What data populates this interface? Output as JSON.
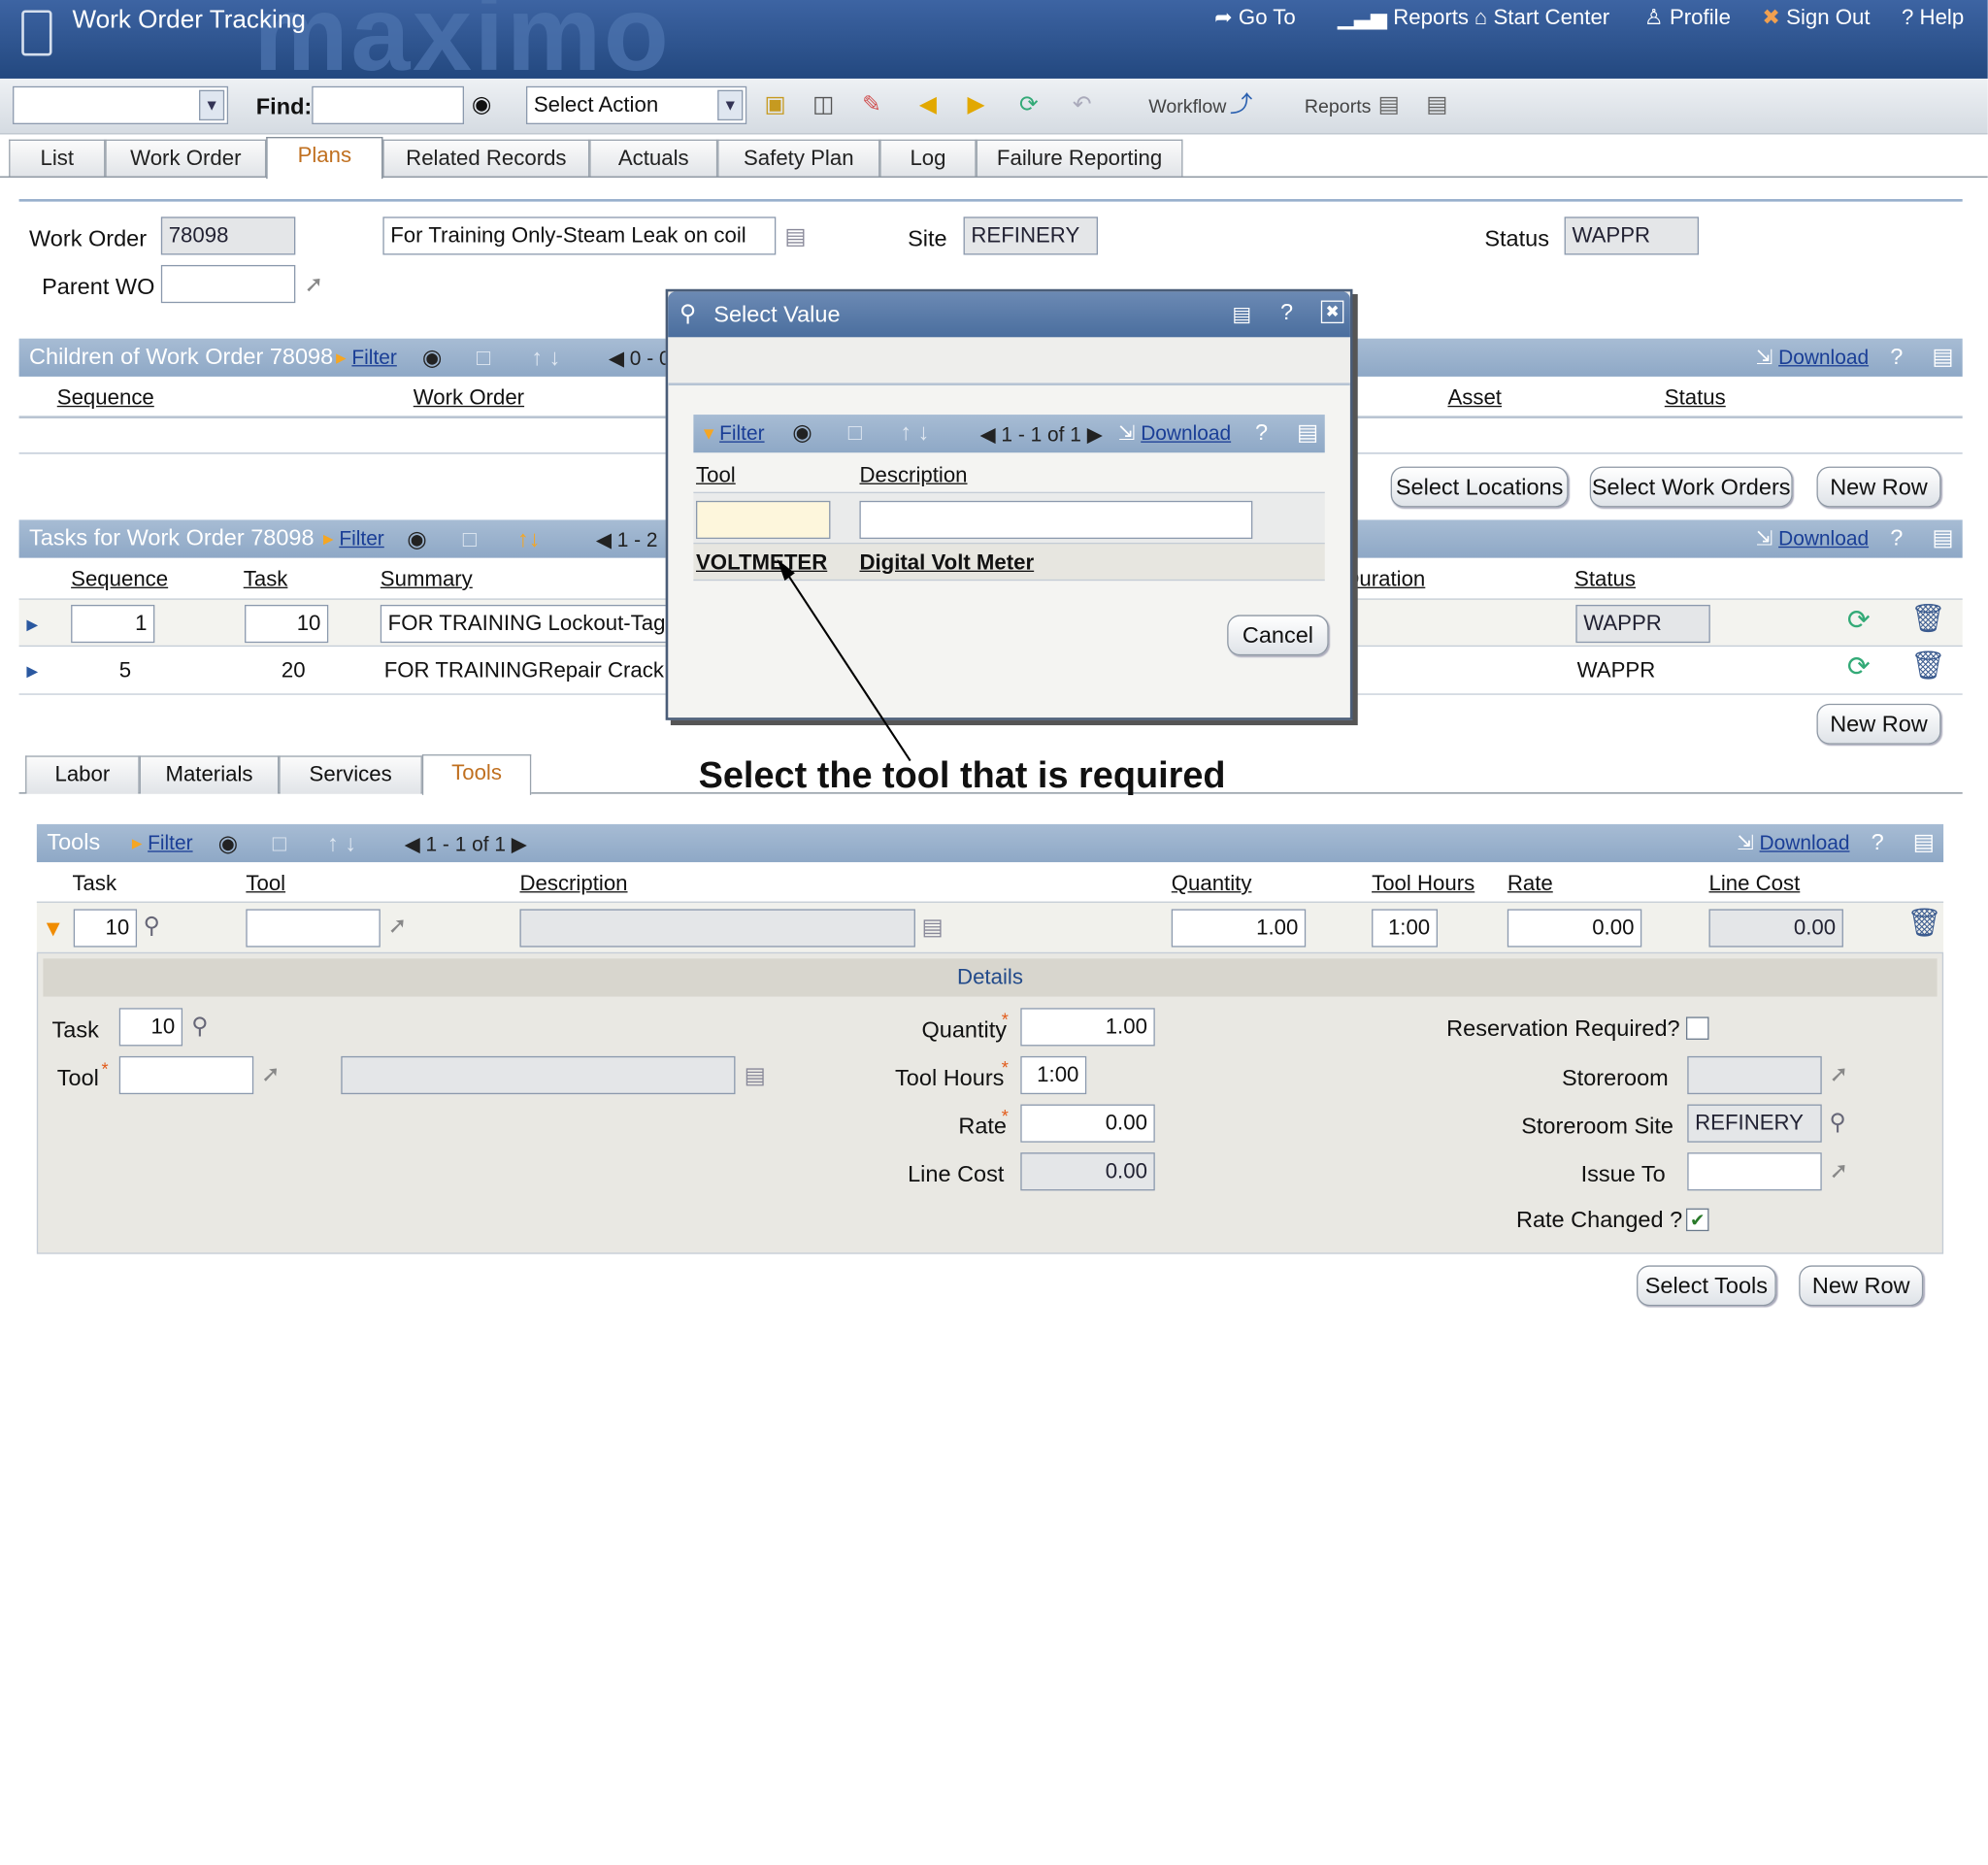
{
  "app": {
    "title": "Work Order Tracking",
    "logo": "maximo"
  },
  "topnav": {
    "goto": "Go To",
    "reports": "Reports",
    "start_center": "Start Center",
    "profile": "Profile",
    "sign_out": "Sign Out",
    "help": "Help"
  },
  "toolbar": {
    "find_label": "Find:",
    "select_action": "Select Action",
    "workflow": "Workflow",
    "reports": "Reports"
  },
  "tabs": [
    "List",
    "Work Order",
    "Plans",
    "Related Records",
    "Actuals",
    "Safety Plan",
    "Log",
    "Failure Reporting"
  ],
  "header": {
    "wo_label": "Work Order",
    "wo_value": "78098",
    "description": "For Training Only-Steam Leak on coil",
    "site_label": "Site",
    "site_value": "REFINERY",
    "status_label": "Status",
    "status_value": "WAPPR",
    "parent_label": "Parent WO",
    "parent_value": ""
  },
  "children": {
    "title": "Children of Work Order 78098",
    "filter": "Filter",
    "paging": "0 - 0",
    "download": "Download",
    "cols": [
      "Sequence",
      "Work Order",
      "Asset",
      "Status"
    ],
    "buttons": [
      "Select Locations",
      "Select Work Orders",
      "New Row"
    ]
  },
  "tasks": {
    "title": "Tasks for Work Order 78098",
    "filter": "Filter",
    "paging": "1 - 2",
    "download": "Download",
    "cols": [
      "Sequence",
      "Task",
      "Summary",
      "Duration",
      "Status"
    ],
    "rows": [
      {
        "seq": "1",
        "task": "10",
        "summary": "FOR TRAINING Lockout-Tagout El",
        "status": "WAPPR"
      },
      {
        "seq": "5",
        "task": "20",
        "summary": "FOR TRAININGRepair Crack in Co",
        "status": "WAPPR"
      }
    ],
    "new_row": "New Row"
  },
  "subtabs": [
    "Labor",
    "Materials",
    "Services",
    "Tools"
  ],
  "tools": {
    "title": "Tools",
    "filter": "Filter",
    "paging": "1 - 1 of 1",
    "download": "Download",
    "cols": [
      "Task",
      "Tool",
      "Description",
      "Quantity",
      "Tool Hours",
      "Rate",
      "Line Cost"
    ],
    "row": {
      "task": "10",
      "tool": "",
      "description": "",
      "quantity": "1.00",
      "hours": "1:00",
      "rate": "0.00",
      "line_cost": "0.00"
    }
  },
  "details": {
    "title": "Details",
    "task_label": "Task",
    "task_value": "10",
    "tool_label": "Tool",
    "quantity_label": "Quantity",
    "quantity_value": "1.00",
    "hours_label": "Tool Hours",
    "hours_value": "1:00",
    "rate_label": "Rate",
    "rate_value": "0.00",
    "linecost_label": "Line Cost",
    "linecost_value": "0.00",
    "reservation_label": "Reservation Required?",
    "storeroom_label": "Storeroom",
    "storesite_label": "Storeroom Site",
    "storesite_value": "REFINERY",
    "issueto_label": "Issue To",
    "ratechanged_label": "Rate Changed ?"
  },
  "bottom_buttons": [
    "Select Tools",
    "New Row"
  ],
  "dialog": {
    "title": "Select Value",
    "filter": "Filter",
    "paging": "1 - 1 of 1",
    "download": "Download",
    "col_tool": "Tool",
    "col_desc": "Description",
    "row_tool": "VOLTMETER",
    "row_desc": "Digital Volt Meter",
    "cancel": "Cancel"
  },
  "annotation": "Select the tool that is required",
  "colors": {
    "banner": "#2f5795",
    "section_bar": "#97afcc",
    "accent_tab": "#c07020"
  }
}
